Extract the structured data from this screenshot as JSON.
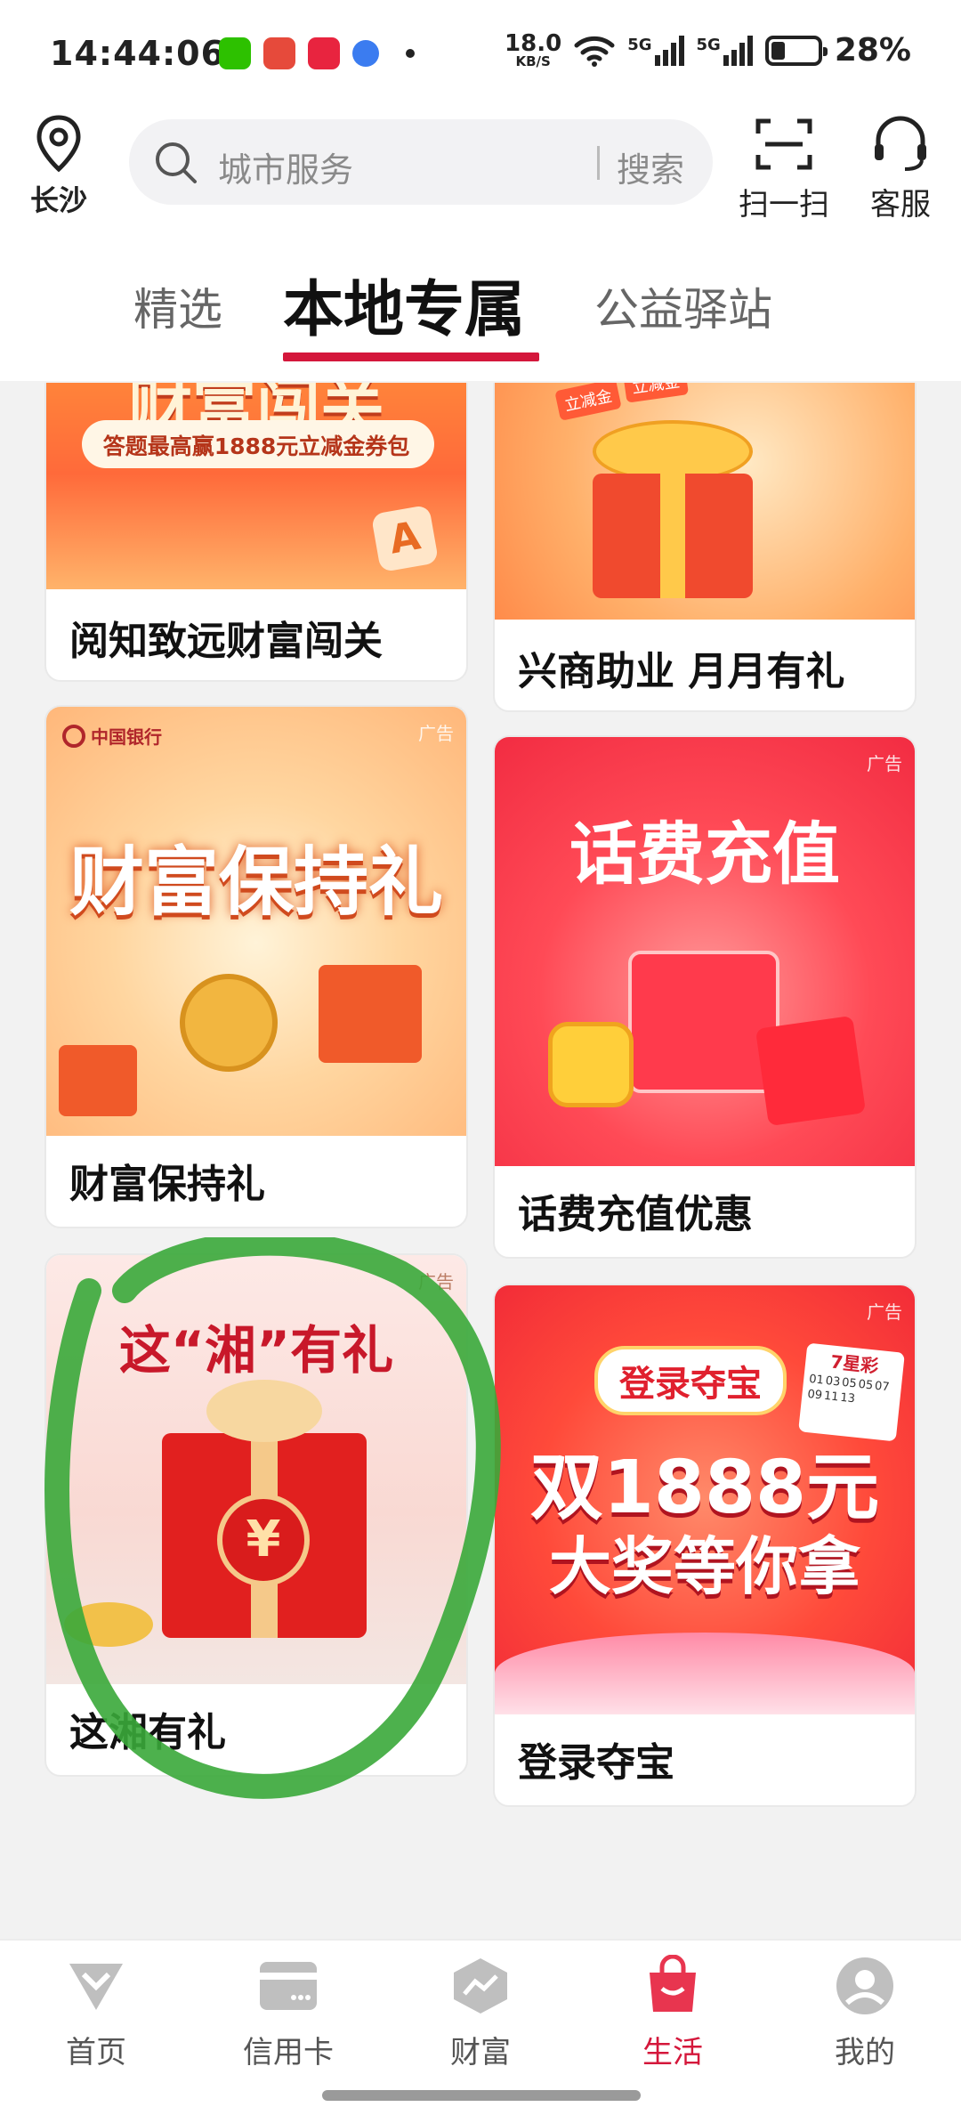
{
  "status_bar": {
    "time": "14:44:06",
    "speed_value": "18.0",
    "speed_unit": "KB/S",
    "network_1": "5G",
    "network_2": "5G",
    "battery": "28%",
    "battery_level": 0.28
  },
  "header": {
    "location": "长沙",
    "search_placeholder": "城市服务",
    "search_button": "搜索",
    "scan_label": "扫一扫",
    "service_label": "客服"
  },
  "tabs": [
    "精选",
    "本地专属",
    "公益驿站"
  ],
  "active_tab": 1,
  "cards": [
    {
      "title": "阅知致远财富闯关",
      "poster_line": "答题最高赢1888元立减金券包",
      "poster_heading": "财富闯关"
    },
    {
      "title": "兴商助业 月月有礼",
      "poster_tags": [
        "立减金",
        "立减金"
      ]
    },
    {
      "title": "财富保持礼",
      "poster_heading": "财富保持礼",
      "ad_label": "广告",
      "bank_logo": "中国银行"
    },
    {
      "title": "话费充值优惠",
      "poster_heading": "话费充值",
      "ad_label": "广告"
    },
    {
      "title": "这湘有礼",
      "poster_heading": "这“湘”有礼",
      "ad_label": "广告",
      "coin_symbol": "¥"
    },
    {
      "title": "登录夺宝",
      "poster_badge": "登录夺宝",
      "poster_line1": "双1888元",
      "poster_line2": "大奖等你拿",
      "ad_label": "广告",
      "lottery_brand": "7星彩",
      "lottery_numbers": [
        "01",
        "03",
        "05",
        "05",
        "07",
        "09",
        "11",
        "13"
      ]
    }
  ],
  "bottom_nav": [
    {
      "label": "首页",
      "icon": "home-diamond-icon"
    },
    {
      "label": "信用卡",
      "icon": "credit-card-icon"
    },
    {
      "label": "财富",
      "icon": "wealth-chart-icon"
    },
    {
      "label": "生活",
      "icon": "shopping-bag-icon"
    },
    {
      "label": "我的",
      "icon": "user-avatar-icon"
    }
  ],
  "active_nav": 3,
  "colors": {
    "accent": "#d4173b",
    "annotation_circle": "#3aa83a"
  }
}
